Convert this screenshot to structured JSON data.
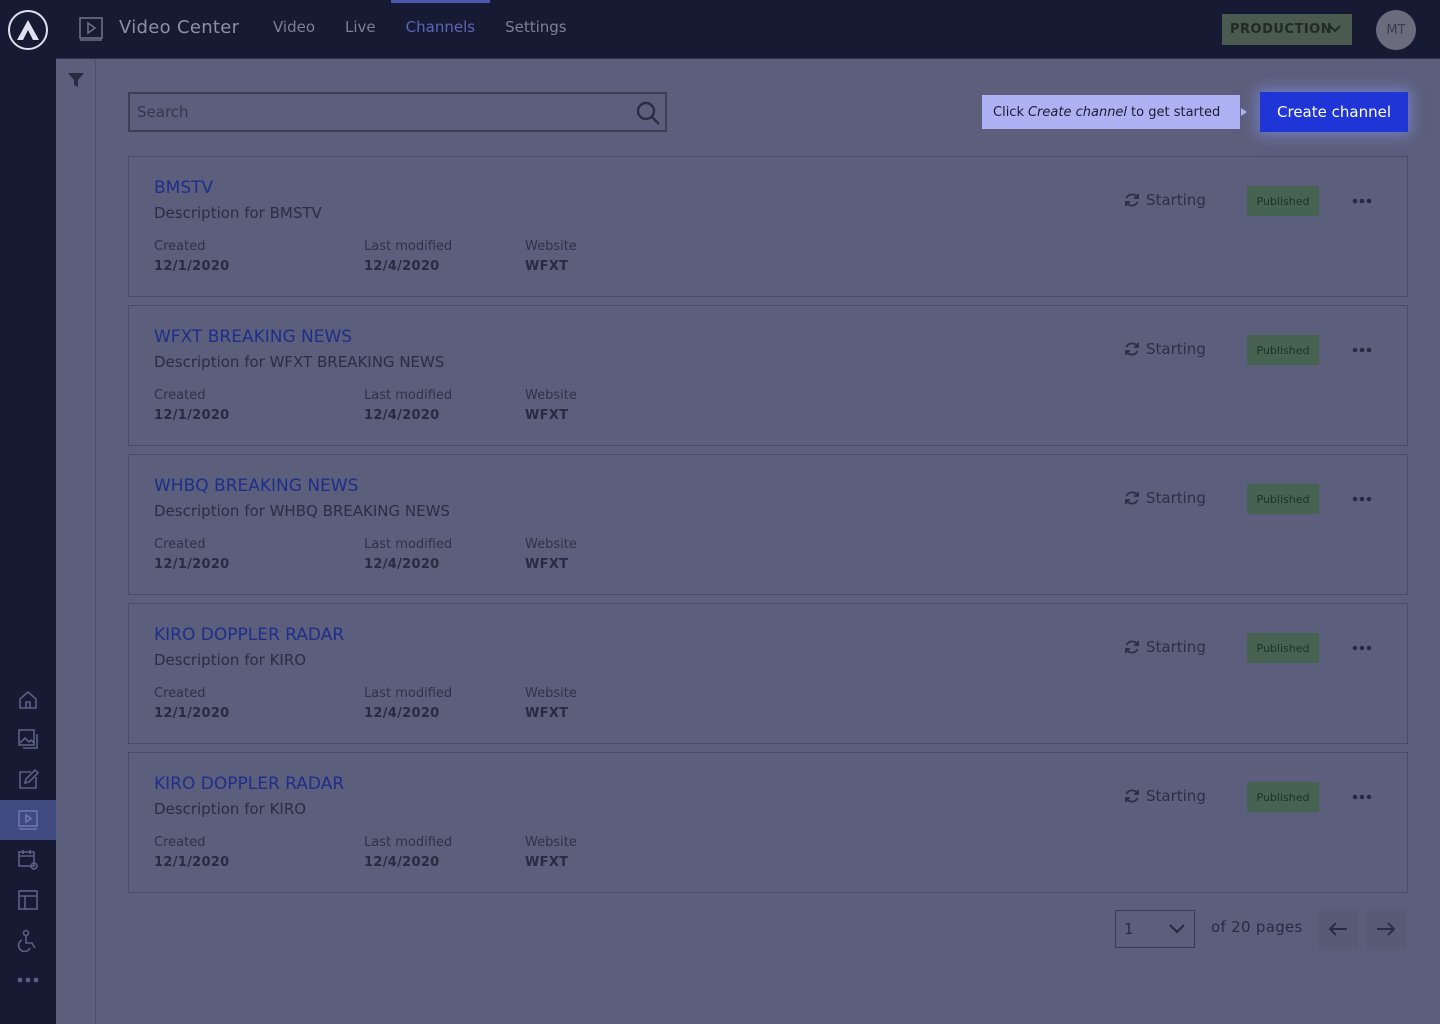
{
  "topbar": {
    "app_title": "Video Center",
    "tabs": [
      {
        "label": "Video",
        "active": false
      },
      {
        "label": "Live",
        "active": false
      },
      {
        "label": "Channels",
        "active": true
      },
      {
        "label": "Settings",
        "active": false
      }
    ],
    "environment": "PRODUCTION",
    "avatar_initials": "MT"
  },
  "rail": {
    "icons": [
      "home-icon",
      "photos-icon",
      "edit-icon",
      "video-center-icon",
      "schedule-settings-icon",
      "layout-icon",
      "accessibility-icon",
      "more-icon"
    ],
    "active": "video-center-icon"
  },
  "search": {
    "placeholder": "Search"
  },
  "hint": {
    "prefix": "Click",
    "emphasis": "Create channel",
    "suffix": "to get started"
  },
  "create_button": "Create channel",
  "meta_labels": {
    "created": "Created",
    "modified": "Last modified",
    "website": "Website"
  },
  "channels": [
    {
      "title": "BMSTV",
      "description": "Description for BMSTV",
      "created": "12/1/2020",
      "modified": "12/4/2020",
      "website": "WFXT",
      "status": "Starting",
      "badge": "Published"
    },
    {
      "title": "WFXT BREAKING NEWS",
      "description": "Description for WFXT BREAKING NEWS",
      "created": "12/1/2020",
      "modified": "12/4/2020",
      "website": "WFXT",
      "status": "Starting",
      "badge": "Published"
    },
    {
      "title": "WHBQ BREAKING NEWS",
      "description": "Description for WHBQ BREAKING NEWS",
      "created": "12/1/2020",
      "modified": "12/4/2020",
      "website": "WFXT",
      "status": "Starting",
      "badge": "Published"
    },
    {
      "title": "KIRO DOPPLER RADAR",
      "description": "Description for KIRO",
      "created": "12/1/2020",
      "modified": "12/4/2020",
      "website": "WFXT",
      "status": "Starting",
      "badge": "Published"
    },
    {
      "title": "KIRO DOPPLER RADAR",
      "description": "Description for KIRO",
      "created": "12/1/2020",
      "modified": "12/4/2020",
      "website": "WFXT",
      "status": "Starting",
      "badge": "Published"
    }
  ],
  "pagination": {
    "current": "1",
    "of_pages": "of 20 pages"
  },
  "colors": {
    "accent": "#1f35d6",
    "topbar": "#171a33",
    "overlay": "#5b5f7b",
    "badge": "#466250"
  }
}
